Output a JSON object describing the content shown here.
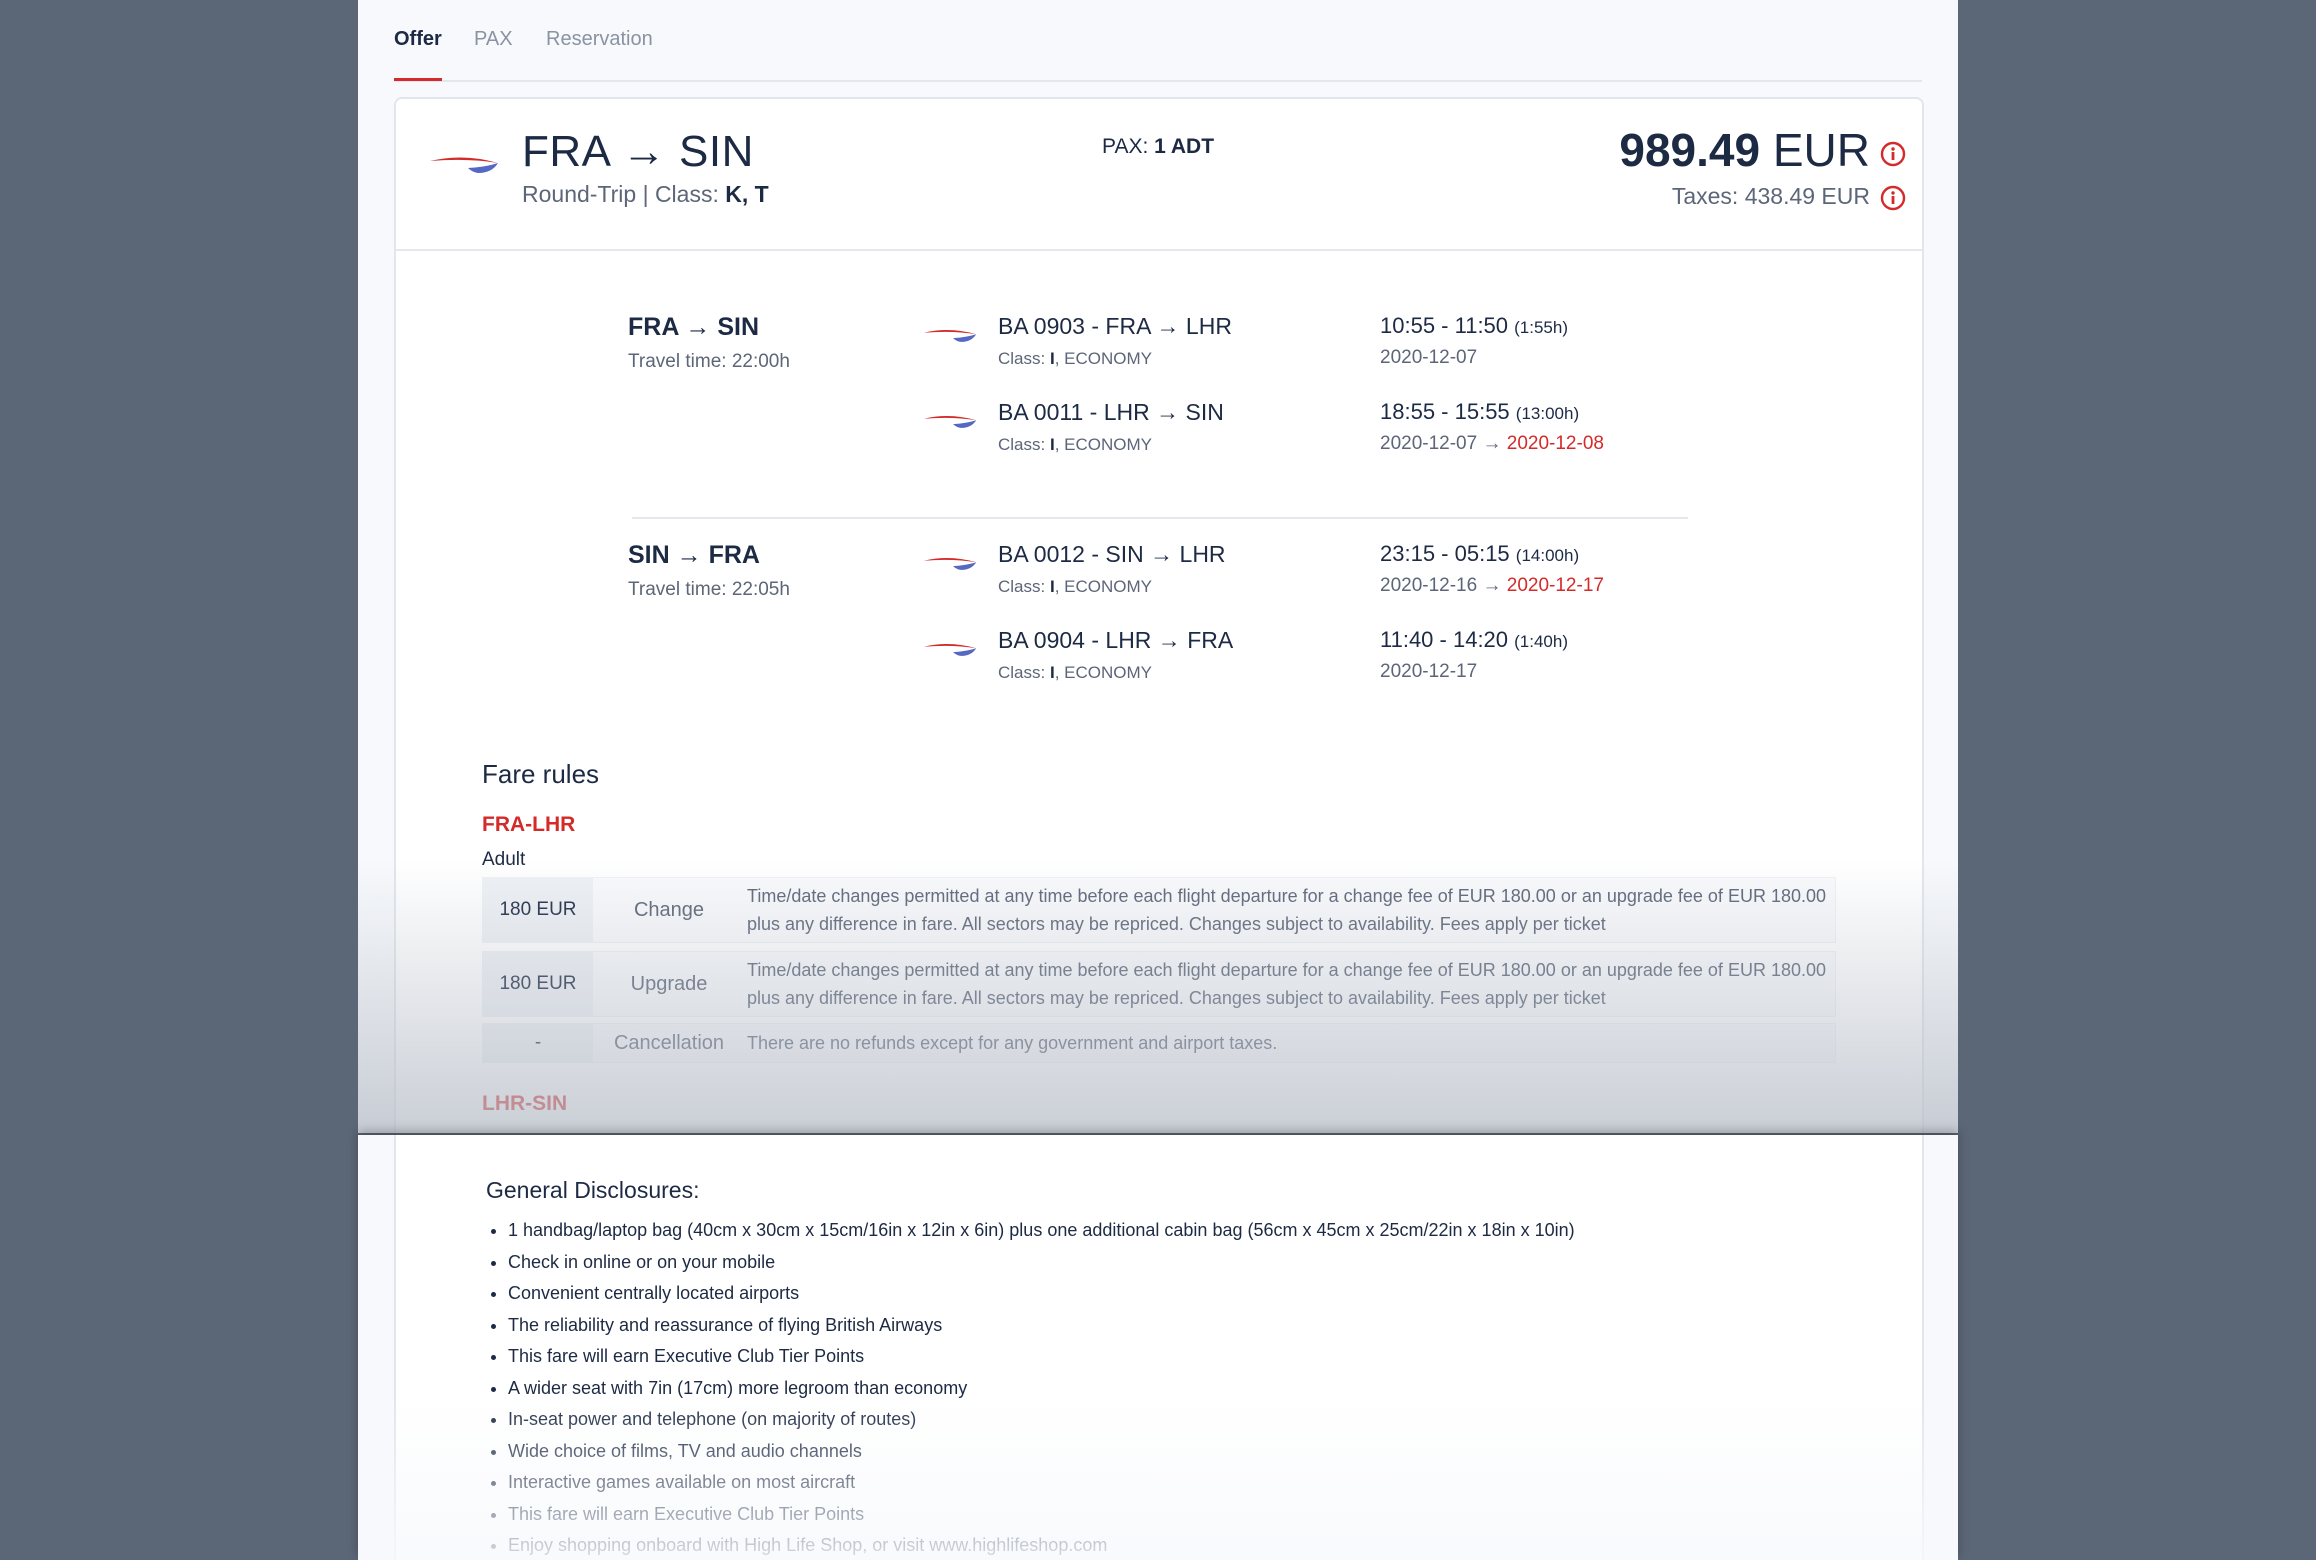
{
  "tabs": [
    {
      "label": "Offer",
      "active": true
    },
    {
      "label": "PAX",
      "active": false
    },
    {
      "label": "Reservation",
      "active": false
    }
  ],
  "colors": {
    "accent": "#d42a2a",
    "text": "#1d2a44",
    "muted": "#5c6678",
    "logo_blue": "#5468c4"
  },
  "offer": {
    "route": "FRA → SIN",
    "trip_type": "Round-Trip | Class: ",
    "classes": "K, T",
    "pax_label": "PAX: ",
    "pax_value": "1 ADT",
    "price_amount": "989.49",
    "price_currency": " EUR",
    "taxes": "Taxes: 438.49 EUR",
    "logo_icon": "airline-logo-icon",
    "info_icon": "info-circle-icon"
  },
  "bounds": [
    {
      "title": "FRA → SIN",
      "travel_time": "Travel time: 22:00h",
      "flights": [
        {
          "name": "BA 0903 - FRA → LHR",
          "class_label": "Class: ",
          "class_code": "I",
          "cabin": ", ECONOMY",
          "time": "10:55 - 11:50 ",
          "duration": "(1:55h)",
          "date": "2020-12-07",
          "arrow": "",
          "arrival_date": ""
        },
        {
          "name": "BA 0011 - LHR → SIN",
          "class_label": "Class: ",
          "class_code": "I",
          "cabin": ", ECONOMY",
          "time": "18:55 - 15:55 ",
          "duration": "(13:00h)",
          "date": "2020-12-07",
          "arrow": " → ",
          "arrival_date": "2020-12-08"
        }
      ]
    },
    {
      "title": "SIN → FRA",
      "travel_time": "Travel time: 22:05h",
      "flights": [
        {
          "name": "BA 0012 - SIN → LHR",
          "class_label": "Class: ",
          "class_code": "I",
          "cabin": ", ECONOMY",
          "time": "23:15 - 05:15 ",
          "duration": "(14:00h)",
          "date": "2020-12-16",
          "arrow": " → ",
          "arrival_date": "2020-12-17"
        },
        {
          "name": "BA 0904 - LHR → FRA",
          "class_label": "Class: ",
          "class_code": "I",
          "cabin": ", ECONOMY",
          "time": "11:40 - 14:20 ",
          "duration": "(1:40h)",
          "date": "2020-12-17",
          "arrow": "",
          "arrival_date": ""
        }
      ]
    }
  ],
  "fare_rules": {
    "heading": "Fare rules",
    "segments": [
      {
        "label": "FRA-LHR",
        "passenger": "Adult",
        "rules": [
          {
            "fee": "180 EUR",
            "type": "Change",
            "text": "Time/date changes permitted at any time before each flight departure for a change fee of EUR 180.00 or an upgrade fee of EUR 180.00 plus any difference in fare. All sectors may be repriced. Changes subject to availability. Fees apply per ticket"
          },
          {
            "fee": "180 EUR",
            "type": "Upgrade",
            "text": "Time/date changes permitted at any time before each flight departure for a change fee of EUR 180.00 or an upgrade fee of EUR 180.00 plus any difference in fare. All sectors may be repriced. Changes subject to availability. Fees apply per ticket"
          },
          {
            "fee": "-",
            "type": "Cancellation",
            "text": "There are no refunds except for any government and airport taxes."
          }
        ]
      },
      {
        "label": "LHR-SIN"
      }
    ]
  },
  "disclosures": {
    "title": "General Disclosures:",
    "items": [
      "1 handbag/laptop bag (40cm x 30cm x 15cm/16in x 12in x 6in) plus one additional cabin bag (56cm x 45cm x 25cm/22in x 18in x 10in)",
      "Check in online or on your mobile",
      "Convenient centrally located airports",
      "The reliability and reassurance of flying British Airways",
      "This fare will earn Executive Club Tier Points",
      "A wider seat with 7in (17cm) more legroom than economy",
      "In-seat power and telephone (on majority of routes)",
      "Wide choice of films, TV and audio channels",
      "Interactive games available on most aircraft",
      "This fare will earn Executive Club Tier Points",
      "Enjoy shopping onboard with High Life Shop, or visit www.highlifeshop.com"
    ]
  }
}
